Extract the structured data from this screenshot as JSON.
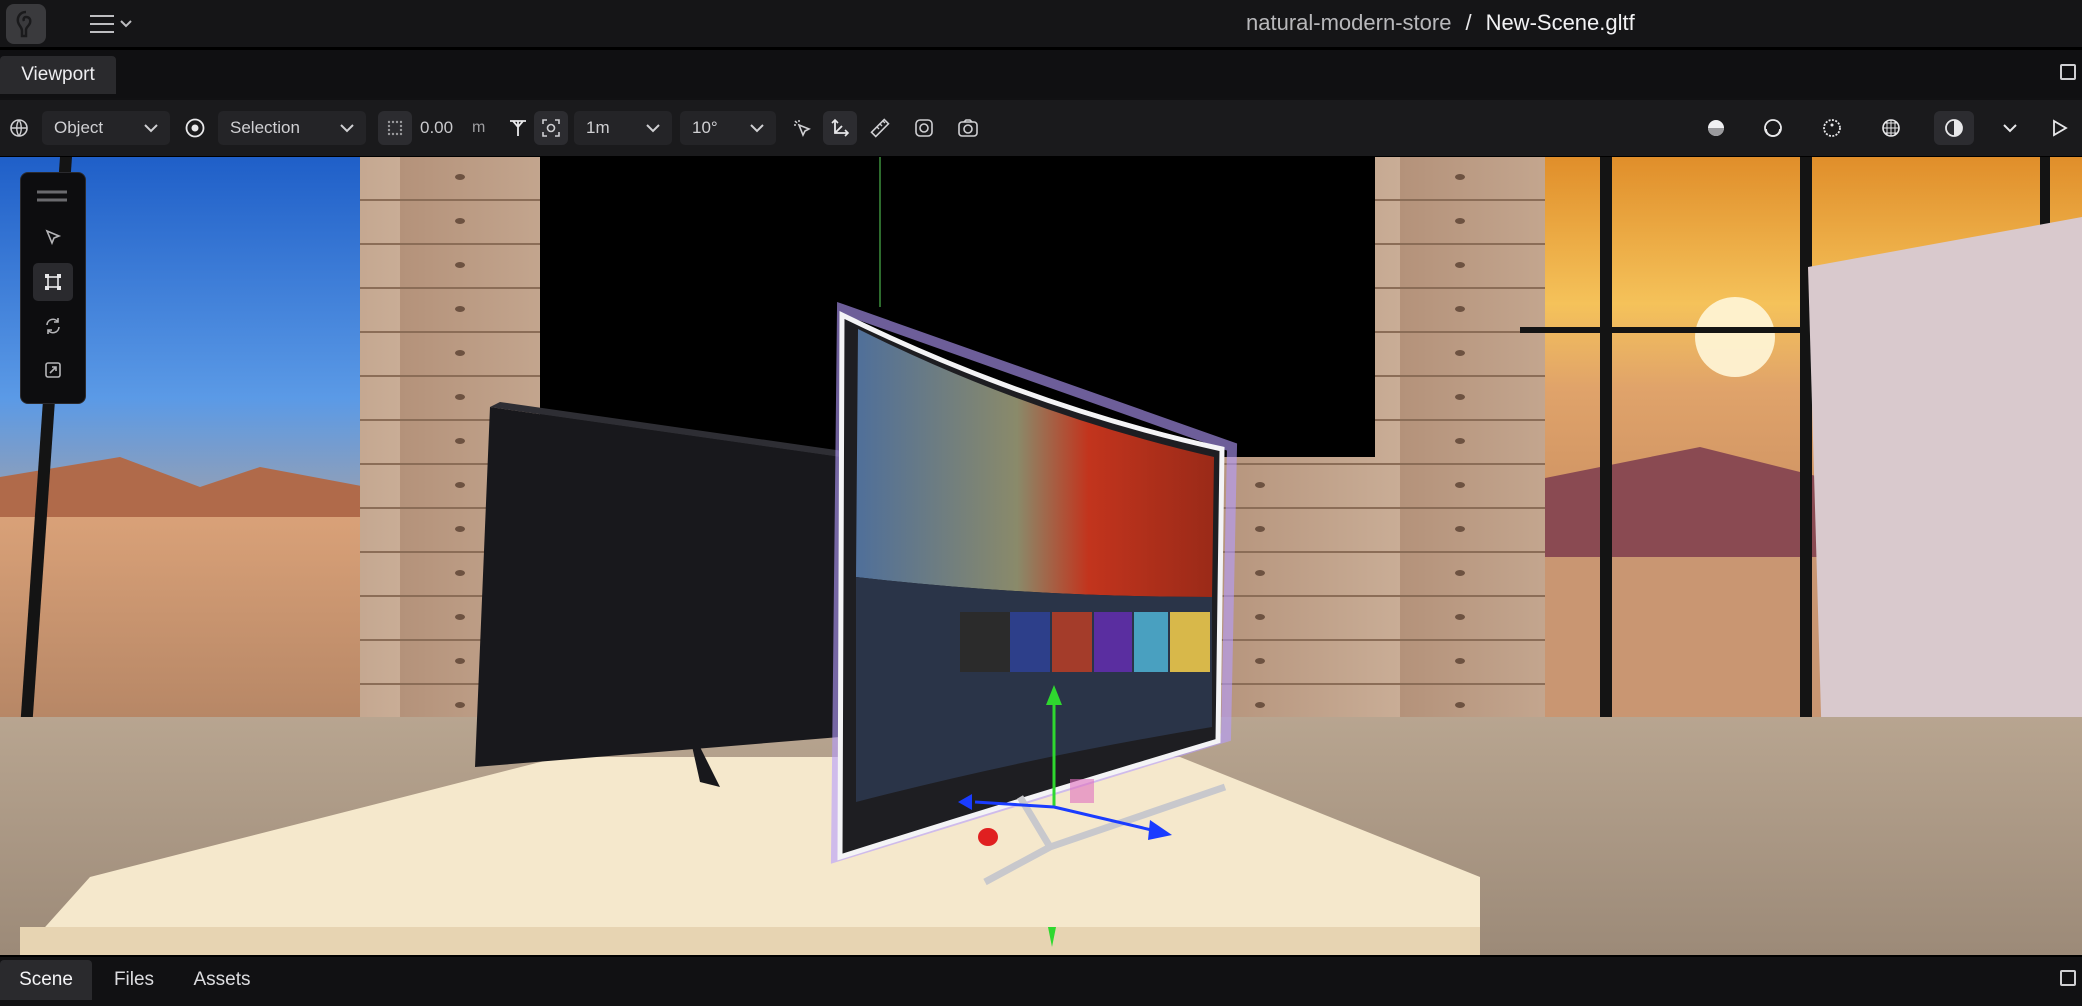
{
  "header": {
    "project_name": "natural-modern-store",
    "separator": "/",
    "file_name": "New-Scene.gltf",
    "logo_icon": "app-logo-icon",
    "menu_icon": "hamburger-menu-icon"
  },
  "panel": {
    "tab_label": "Viewport"
  },
  "toolbar": {
    "space_mode": "Object",
    "pivot_mode": "Selection",
    "snap_value": "0.00",
    "snap_unit": "m",
    "grid_size": "1m",
    "rotation_snap": "10°"
  },
  "tools": [
    "select-tool",
    "translate-tool",
    "rotate-tool",
    "scale-tool"
  ],
  "bottom_tabs": [
    {
      "label": "Scene",
      "active": true
    },
    {
      "label": "Files",
      "active": false
    },
    {
      "label": "Assets",
      "active": false
    }
  ],
  "colors": {
    "background": "#111113",
    "toolbar": "#1a1a1c",
    "active_tab": "#2a2a2d",
    "gizmo_x": "#e02020",
    "gizmo_y": "#2fd82f",
    "gizmo_z": "#1a3cff"
  }
}
